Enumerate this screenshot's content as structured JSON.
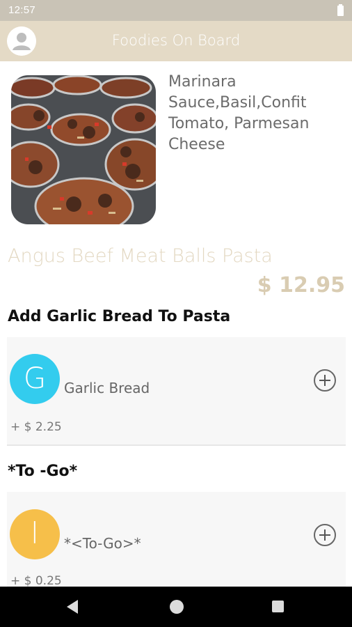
{
  "status_bar": {
    "time": "12:57"
  },
  "app_bar": {
    "title": "Foodies On Board"
  },
  "product": {
    "description": "Marinara Sauce,Basil,Confit Tomato, Parmesan Cheese",
    "name": "Angus Beef Meat Balls Pasta",
    "price": "$ 12.95"
  },
  "sections": [
    {
      "title": "Add Garlic Bread To Pasta",
      "options": [
        {
          "letter": "G",
          "name": "Garlic Bread",
          "price": "+ $ 2.25",
          "color": "#33ccee"
        }
      ]
    },
    {
      "title": "*To -Go*",
      "options": [
        {
          "letter": "l",
          "name": "*<To-Go>*",
          "price": "+ $ 0.25",
          "color": "#f6bf4a"
        }
      ]
    }
  ],
  "icons": {
    "avatar": "avatar-icon",
    "battery": "battery-icon",
    "add": "plus-circle-icon",
    "nav_back": "back-icon",
    "nav_home": "home-icon",
    "nav_recents": "recents-icon"
  }
}
